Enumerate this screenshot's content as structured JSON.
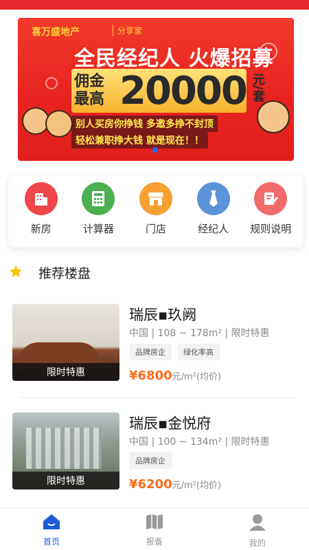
{
  "banner": {
    "brand": "喜万盛地产",
    "brand_sub": "分享家",
    "headline": "全民经纪人 火爆招募",
    "commission_left": "佣金\n最高",
    "commission_value": "20000",
    "commission_unit": "元/套",
    "slogan_1": "别人买房你挣钱  多邀多挣不封顶",
    "slogan_2": "轻松兼职挣大钱  就是现在！！"
  },
  "menu": [
    {
      "label": "新房",
      "icon": "building-icon",
      "color": "#f0474b"
    },
    {
      "label": "计算器",
      "icon": "calculator-icon",
      "color": "#4caf50"
    },
    {
      "label": "门店",
      "icon": "store-icon",
      "color": "#f5a030"
    },
    {
      "label": "经纪人",
      "icon": "tie-icon",
      "color": "#5b93d8"
    },
    {
      "label": "规则说明",
      "icon": "rules-icon",
      "color": "#f26b6b"
    }
  ],
  "section": {
    "title": "推荐楼盘"
  },
  "listings": [
    {
      "title": "瑞辰▪玖阙",
      "meta": "中国 | 108 ~ 178m² | 限时特惠",
      "tags": [
        "品牌房企",
        "绿化率高"
      ],
      "price_value": "¥6800",
      "price_unit": "元/m²(均价)",
      "badge": "限时特惠"
    },
    {
      "title": "瑞辰▪金悦府",
      "meta": "中国 | 100 ~ 134m² | 限时特惠",
      "tags": [
        "品牌房企"
      ],
      "price_value": "¥6200",
      "price_unit": "元/m²(均价)",
      "badge": "限时特惠"
    }
  ],
  "nav": [
    {
      "label": "首页",
      "icon": "home-icon",
      "active": true
    },
    {
      "label": "报备",
      "icon": "map-icon",
      "active": false
    },
    {
      "label": "我的",
      "icon": "user-icon",
      "active": false
    }
  ],
  "colors": {
    "brand_red": "#e8282b",
    "price_orange": "#ff6a1a",
    "nav_active": "#1f5bd6"
  }
}
